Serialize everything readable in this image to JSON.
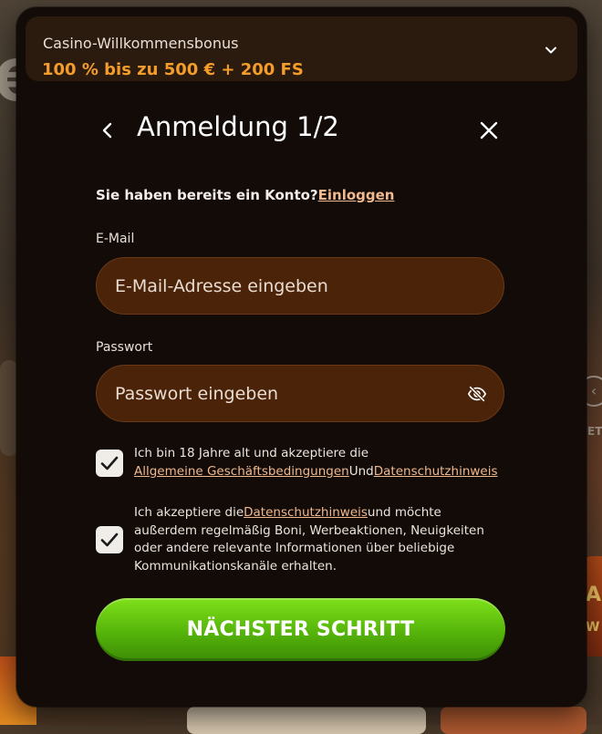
{
  "bonus": {
    "title": "Casino-Willkommensbonus",
    "offer": "100 % bis zu 500 € + 200 FS"
  },
  "header": {
    "title": "Anmeldung 1/2"
  },
  "login": {
    "question": "Sie haben bereits ein Konto?",
    "link": "Einloggen"
  },
  "email": {
    "label": "E-Mail",
    "placeholder": "E-Mail-Adresse eingeben",
    "value": ""
  },
  "password": {
    "label": "Passwort",
    "placeholder": "Passwort eingeben",
    "value": ""
  },
  "consent_terms": {
    "checked": true,
    "text_before": "Ich bin 18 Jahre alt und akzeptiere die",
    "link_terms": "Allgemeine Geschäftsbedingungen",
    "connector": "Und",
    "link_privacy": "Datenschutzhinweis"
  },
  "consent_marketing": {
    "checked": true,
    "text_before": "Ich akzeptiere die",
    "link_privacy": "Datenschutzhinweis",
    "text_after": "und möchte außerdem regelmäßig Boni, Werbeaktionen, Neuigkeiten oder andere relevante Informationen über beliebige Kommunikationskanäle erhalten."
  },
  "next_button": {
    "label": "NÄCHSTER SCHRITT"
  },
  "colors": {
    "modal_bg": "#120b07",
    "bonus_bg": "#2b1a0e",
    "offer_orange": "#f59d2a",
    "input_bg": "#4b2309",
    "link_peach": "#f0b98e",
    "button_green": "#55b40a"
  },
  "icons": {
    "bonus_toggle": "chevron-down-icon",
    "back": "chevron-left-icon",
    "close": "close-icon",
    "password_visibility": "eye-off-icon",
    "checkbox_mark": "check-icon"
  },
  "background": {
    "euro_glyph": "€",
    "right_snippet": "ET",
    "right_art_a": "A",
    "right_art_w": "W"
  }
}
